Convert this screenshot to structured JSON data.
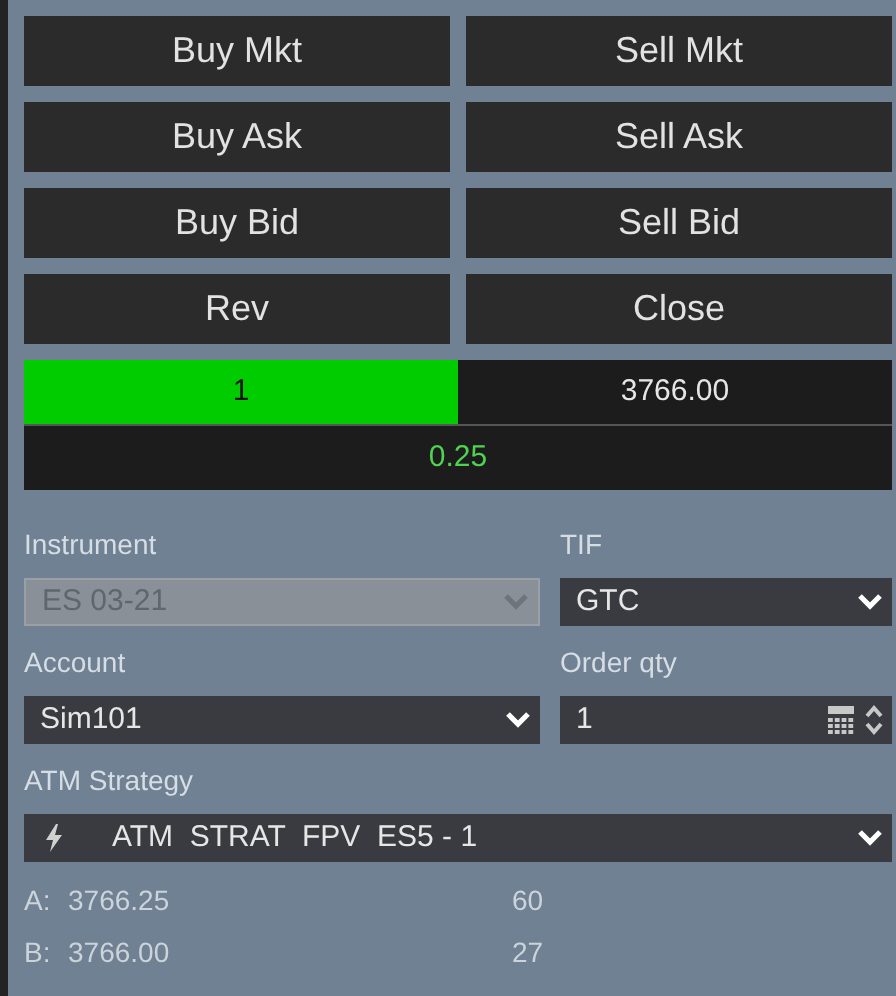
{
  "buttons": [
    {
      "label": "Buy Mkt"
    },
    {
      "label": "Sell Mkt"
    },
    {
      "label": "Buy Ask"
    },
    {
      "label": "Sell Ask"
    },
    {
      "label": "Buy Bid"
    },
    {
      "label": "Sell Bid"
    },
    {
      "label": "Rev"
    },
    {
      "label": "Close"
    }
  ],
  "position": {
    "quantity": "1",
    "price": "3766.00",
    "pnl": "0.25"
  },
  "fields": [
    {
      "kind": "select",
      "label": "Instrument",
      "value": "ES 03-21",
      "disabled": true
    },
    {
      "kind": "select",
      "label": "TIF",
      "value": "GTC",
      "disabled": false
    },
    {
      "kind": "select",
      "label": "Account",
      "value": "Sim101",
      "disabled": false
    },
    {
      "kind": "quantity",
      "label": "Order qty",
      "value": "1",
      "disabled": false
    }
  ],
  "atm_strategy": {
    "label": "ATM Strategy",
    "value": "ATM  STRAT  FPV  ES5 - 1"
  },
  "quotes": [
    {
      "label": "A:",
      "price": "3766.25",
      "size": "60"
    },
    {
      "label": "B:",
      "price": "3766.00",
      "size": "27"
    }
  ]
}
